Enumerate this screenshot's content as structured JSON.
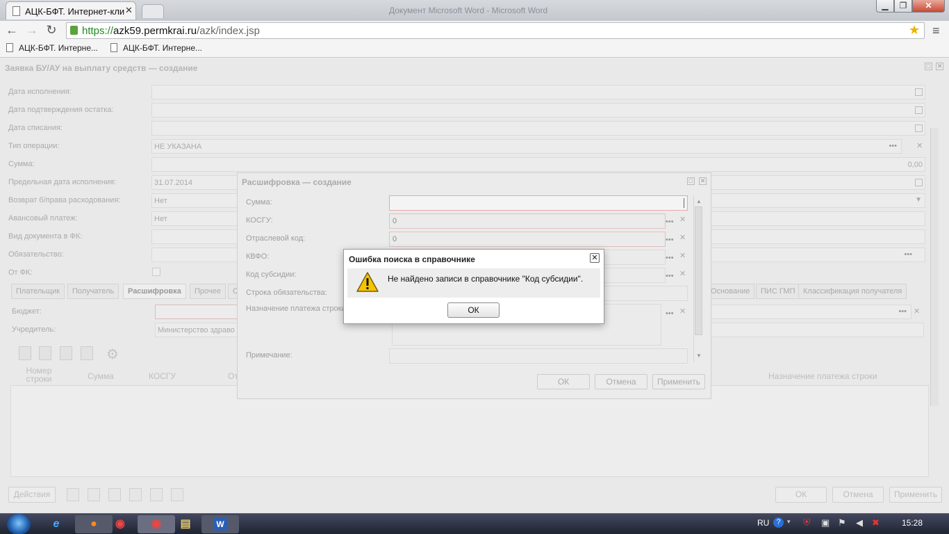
{
  "browser": {
    "tab_title": "АЦК-БФТ. Интернет-кли",
    "tab_close": "✕",
    "window_title": "Документ Microsoft Word - Microsoft Word",
    "url_scheme": "https://",
    "url_host": "azk59.permkrai.ru",
    "url_path": "/azk/index.jsp",
    "bookmarks": [
      "АЦК-БФТ. Интерне...",
      "АЦК-БФТ. Интерне..."
    ]
  },
  "app": {
    "title": "Заявка БУ/АУ на выплату средств — создание",
    "fields": [
      {
        "label": "Дата исполнения:",
        "value": ""
      },
      {
        "label": "Дата подтверждения остатка:",
        "value": ""
      },
      {
        "label": "Дата списания:",
        "value": ""
      },
      {
        "label": "Тип операции:",
        "value": "НЕ УКАЗАНА"
      },
      {
        "label": "Сумма:",
        "value": "0,00"
      },
      {
        "label": "Предельная дата исполнения:",
        "value": "31.07.2014"
      },
      {
        "label": "Возврат б/права расходования:",
        "value": "Нет"
      },
      {
        "label": "Авансовый платеж:",
        "value": "Нет"
      },
      {
        "label": "Вид документа в ФК:",
        "value": ""
      },
      {
        "label": "Обязательство:",
        "value": ""
      },
      {
        "label": "От ФК:",
        "value": ""
      }
    ],
    "tabs": [
      "Плательщик",
      "Получатель",
      "Расшифровка",
      "Прочее",
      "С",
      "Основание",
      "ПИС ГМП",
      "Классификация получателя"
    ],
    "budget_label": "Бюджет:",
    "founder_label": "Учредитель:",
    "founder_value": "Министерство здраво",
    "grid_columns": [
      "Номер строки",
      "Сумма",
      "КОСГУ",
      "От",
      "Назначение платежа строки"
    ],
    "bottom_buttons": {
      "actions": "Действия",
      "ok": "ОК",
      "cancel": "Отмена",
      "apply": "Применить"
    }
  },
  "dialog": {
    "title": "Расшифровка — создание",
    "fields": [
      {
        "label": "Сумма:",
        "value": ""
      },
      {
        "label": "КОСГУ:",
        "value": "0"
      },
      {
        "label": "Отраслевой код:",
        "value": "0"
      },
      {
        "label": "КВФО:",
        "value": ""
      },
      {
        "label": "Код субсидии:",
        "value": ""
      },
      {
        "label": "Строка обязательства:",
        "value": ""
      },
      {
        "label": "Назначение платежа строки:",
        "value": ""
      },
      {
        "label": "Примечание:",
        "value": ""
      }
    ],
    "buttons": {
      "ok": "ОК",
      "cancel": "Отмена",
      "apply": "Применить"
    }
  },
  "modal": {
    "title": "Ошибка поиска в справочнике",
    "close": "✕",
    "message": "Не найдено записи в справочнике \"Код субсидии\".",
    "ok": "ОК"
  },
  "taskbar": {
    "lang": "RU",
    "time": "15:28"
  },
  "colors": {
    "warning": "#f5c400",
    "secure": "#1c8a1c",
    "close_button": "#c74a34"
  }
}
